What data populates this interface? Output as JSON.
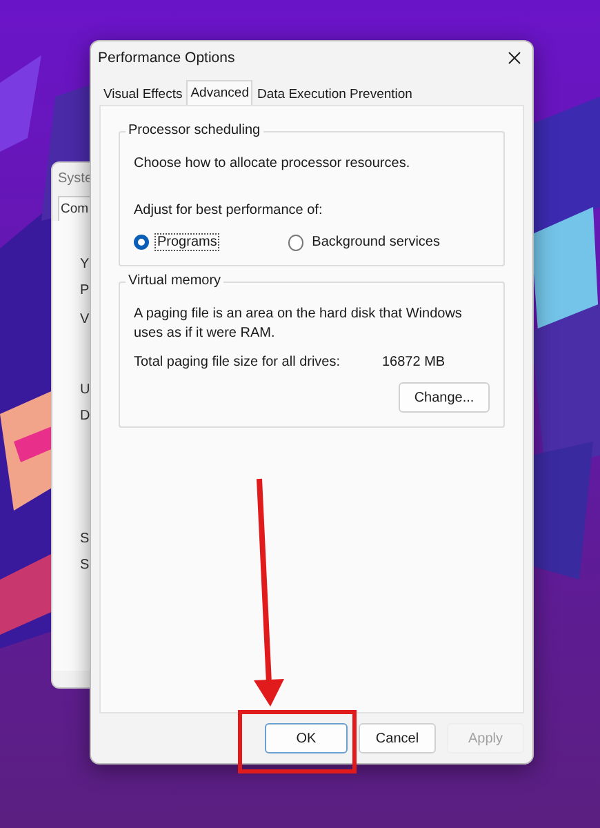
{
  "background_window": {
    "title": "Syste",
    "tab": "Com",
    "fragments": [
      "Y",
      "P",
      "V",
      "U",
      "D",
      "S",
      "S"
    ]
  },
  "dialog": {
    "title": "Performance Options",
    "tabs": [
      {
        "label": "Visual Effects",
        "selected": false
      },
      {
        "label": "Advanced",
        "selected": true
      },
      {
        "label": "Data Execution Prevention",
        "selected": false
      }
    ],
    "processor_scheduling": {
      "heading": "Processor scheduling",
      "description": "Choose how to allocate processor resources.",
      "prompt": "Adjust for best performance of:",
      "options": [
        {
          "label": "Programs",
          "selected": true
        },
        {
          "label": "Background services",
          "selected": false
        }
      ]
    },
    "virtual_memory": {
      "heading": "Virtual memory",
      "description": "A paging file is an area on the hard disk that Windows uses as if it were RAM.",
      "size_label": "Total paging file size for all drives:",
      "size_value": "16872 MB",
      "button": "Change..."
    },
    "buttons": [
      {
        "label": "OK",
        "disabled": false,
        "focused": true
      },
      {
        "label": "Cancel",
        "disabled": false,
        "focused": false
      },
      {
        "label": "Apply",
        "disabled": true,
        "focused": false
      }
    ]
  }
}
